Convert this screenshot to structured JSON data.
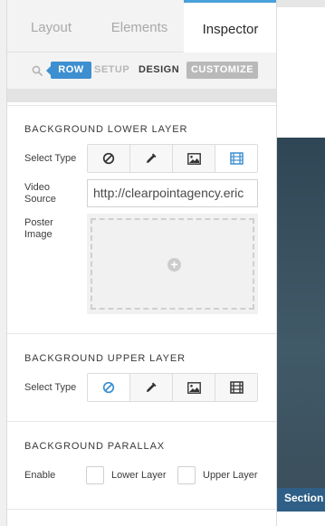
{
  "tabs": [
    {
      "label": "Layout"
    },
    {
      "label": "Elements"
    },
    {
      "label": "Inspector"
    }
  ],
  "subnav": {
    "row": "ROW",
    "setup": "SETUP",
    "design": "DESIGN",
    "customize": "CUSTOMIZE"
  },
  "lower_layer": {
    "title": "BACKGROUND LOWER LAYER",
    "select_type_label": "Select Type",
    "types": [
      "none-icon",
      "eyedropper-icon",
      "image-icon",
      "video-icon"
    ],
    "active_type": "video",
    "video_source_label": "Video\nSource",
    "video_source_value": "http://clearpointagency.eric",
    "poster_label": "Poster\nImage"
  },
  "upper_layer": {
    "title": "BACKGROUND UPPER LAYER",
    "select_type_label": "Select Type",
    "types": [
      "none-icon",
      "eyedropper-icon",
      "image-icon",
      "video-icon"
    ],
    "active_type": "none"
  },
  "parallax": {
    "title": "BACKGROUND PARALLAX",
    "enable_label": "Enable",
    "lower_label": "Lower Layer",
    "upper_label": "Upper Layer"
  },
  "canvas": {
    "section_label": "Section"
  },
  "colors": {
    "accent": "#3d8fd0",
    "active_icon": "#3d8fd0",
    "section_bar": "#2f5f86"
  }
}
